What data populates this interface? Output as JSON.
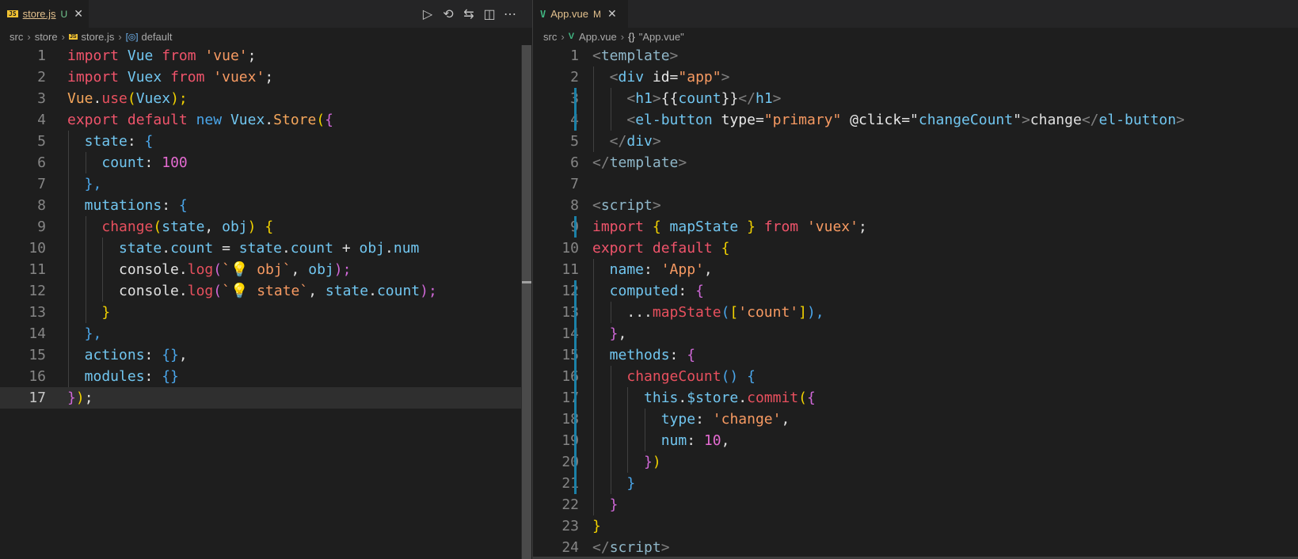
{
  "left_editor": {
    "tab": {
      "icon": "js-file-icon",
      "icon_text": "JS",
      "file_name": "store.js",
      "status": "U",
      "status_color": "#73c991"
    },
    "actions": [
      "run-icon",
      "timeline-icon",
      "compare-changes-icon",
      "split-editor-icon",
      "more-actions-icon"
    ],
    "actions_text": [
      "▷",
      "⟲",
      "⇆",
      "◫",
      "⋯"
    ],
    "breadcrumb": {
      "folder1": "src",
      "folder2": "store",
      "file": "store.js",
      "symbol": "default"
    },
    "current_line": "17",
    "lines": [
      {
        "num": "1",
        "indent": 0
      },
      {
        "num": "2",
        "indent": 0
      },
      {
        "num": "3",
        "indent": 0
      },
      {
        "num": "4",
        "indent": 0
      },
      {
        "num": "5",
        "indent": 1
      },
      {
        "num": "6",
        "indent": 2
      },
      {
        "num": "7",
        "indent": 1
      },
      {
        "num": "8",
        "indent": 1
      },
      {
        "num": "9",
        "indent": 2
      },
      {
        "num": "10",
        "indent": 3
      },
      {
        "num": "11",
        "indent": 3
      },
      {
        "num": "12",
        "indent": 3
      },
      {
        "num": "13",
        "indent": 2
      },
      {
        "num": "14",
        "indent": 1
      },
      {
        "num": "15",
        "indent": 1
      },
      {
        "num": "16",
        "indent": 1
      },
      {
        "num": "17",
        "indent": 0
      }
    ]
  },
  "right_editor": {
    "tab": {
      "icon": "vue-file-icon",
      "icon_text": "V",
      "file_name": "App.vue",
      "status": "M",
      "status_color": "#e2c08d"
    },
    "breadcrumb": {
      "folder1": "src",
      "file": "App.vue",
      "symbol": "\"App.vue\""
    },
    "lines": [
      {
        "num": "1",
        "indent": 0
      },
      {
        "num": "2",
        "indent": 1
      },
      {
        "num": "3",
        "indent": 2
      },
      {
        "num": "4",
        "indent": 2
      },
      {
        "num": "5",
        "indent": 1
      },
      {
        "num": "6",
        "indent": 0
      },
      {
        "num": "7",
        "indent": 0
      },
      {
        "num": "8",
        "indent": 0
      },
      {
        "num": "9",
        "indent": 0
      },
      {
        "num": "10",
        "indent": 0
      },
      {
        "num": "11",
        "indent": 1
      },
      {
        "num": "12",
        "indent": 1
      },
      {
        "num": "13",
        "indent": 2
      },
      {
        "num": "14",
        "indent": 1
      },
      {
        "num": "15",
        "indent": 1
      },
      {
        "num": "16",
        "indent": 2
      },
      {
        "num": "17",
        "indent": 3
      },
      {
        "num": "18",
        "indent": 4
      },
      {
        "num": "19",
        "indent": 4
      },
      {
        "num": "20",
        "indent": 3
      },
      {
        "num": "21",
        "indent": 2
      },
      {
        "num": "22",
        "indent": 1
      },
      {
        "num": "23",
        "indent": 0
      },
      {
        "num": "24",
        "indent": 0
      }
    ],
    "modified_lines": [
      "3",
      "4",
      "9",
      "12",
      "13",
      "14",
      "15",
      "16",
      "17",
      "18",
      "19",
      "20",
      "21"
    ]
  },
  "tokens": {
    "l1": [
      "import",
      "Vue",
      "from",
      "'vue'",
      ";"
    ],
    "l2": [
      "import",
      "Vuex",
      "from",
      "'vuex'",
      ";"
    ],
    "l3": [
      "Vue",
      ".",
      "use",
      "(",
      "Vuex",
      ");"
    ],
    "l4": [
      "export",
      "default",
      "new",
      "Vuex",
      ".",
      "Store",
      "(",
      "{"
    ],
    "l5": [
      "state",
      ": ",
      "{"
    ],
    "l6": [
      "count",
      ": ",
      "100"
    ],
    "l7": [
      "},"
    ],
    "l8": [
      "mutations",
      ": ",
      "{"
    ],
    "l9": [
      "change",
      "(",
      "state",
      ", ",
      "obj",
      ") ",
      "{"
    ],
    "l10": [
      "state",
      ".",
      "count",
      " = ",
      "state",
      ".",
      "count",
      " + ",
      "obj",
      ".",
      "num"
    ],
    "l11": [
      "console",
      ".",
      "log",
      "(",
      "`",
      "💡",
      " obj`",
      ", ",
      "obj",
      ");"
    ],
    "l12": [
      "console",
      ".",
      "log",
      "(",
      "`",
      "💡",
      " state`",
      ", ",
      "state",
      ".",
      "count",
      ");"
    ],
    "l13": [
      "}"
    ],
    "l14": [
      "},"
    ],
    "l15": [
      "actions",
      ": ",
      "{}",
      ","
    ],
    "l16": [
      "modules",
      ": ",
      "{}"
    ],
    "l17": [
      "}",
      ")",
      ";"
    ],
    "r1": [
      "<",
      "template",
      ">"
    ],
    "r2": [
      "<",
      "div",
      " id",
      "=",
      "\"app\"",
      ">"
    ],
    "r3": [
      "<",
      "h1",
      ">",
      "{{",
      "count",
      "}}",
      "</",
      "h1",
      ">"
    ],
    "r4": [
      "<",
      "el-button",
      " type",
      "=",
      "\"primary\"",
      " @click",
      "=\"",
      "changeCount",
      "\"",
      ">",
      "change",
      "</",
      "el-button",
      ">"
    ],
    "r5": [
      "</",
      "div",
      ">"
    ],
    "r6": [
      "</",
      "template",
      ">"
    ],
    "r8": [
      "<",
      "script",
      ">"
    ],
    "r9": [
      "import",
      " { ",
      "mapState",
      " } ",
      "from",
      " 'vuex'",
      ";"
    ],
    "r10": [
      "export",
      " default",
      " {"
    ],
    "r11": [
      "name",
      ": ",
      "'App'",
      ","
    ],
    "r12": [
      "computed",
      ": ",
      "{"
    ],
    "r13": [
      "...",
      "mapState",
      "(",
      "[",
      "'count'",
      "]",
      "),"
    ],
    "r14": [
      "}",
      ","
    ],
    "r15": [
      "methods",
      ": ",
      "{"
    ],
    "r16": [
      "changeCount",
      "()",
      " {"
    ],
    "r17": [
      "this",
      ".",
      "$store",
      ".",
      "commit",
      "(",
      "{"
    ],
    "r18": [
      "type",
      ": ",
      "'change'",
      ","
    ],
    "r19": [
      "num",
      ": ",
      "10",
      ","
    ],
    "r20": [
      "}",
      ")"
    ],
    "r21": [
      "}"
    ],
    "r22": [
      "}"
    ],
    "r23": [
      "}"
    ],
    "r24": [
      "</",
      "script",
      ">"
    ]
  },
  "colors": {
    "keyword": "#f0546b",
    "string": "#f79a62",
    "variable": "#71c6f0",
    "function": "#f5a65b",
    "number": "#e46bd1",
    "bracket_level1": "#f2d200",
    "bracket_level2": "#d068d8",
    "bracket_level3": "#4aa6ea",
    "modified_gutter": "#1b81a8",
    "editor_background": "#1e1e1e"
  }
}
